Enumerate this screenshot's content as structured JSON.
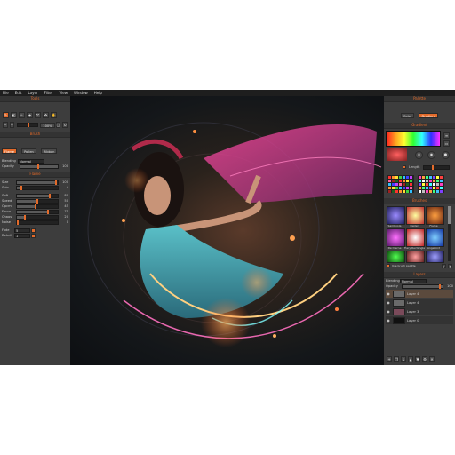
{
  "menu": [
    "File",
    "Edit",
    "Layer",
    "Filter",
    "View",
    "Window",
    "Help"
  ],
  "tools": {
    "title": "Tools",
    "zoom_value": "100%"
  },
  "brush": {
    "title": "Brush",
    "modes": [
      "Flame",
      "Pollen",
      "Ribbon"
    ],
    "blending_label": "Blending",
    "blending_value": "Normal",
    "opacity_label": "Opacity",
    "opacity_value": "100"
  },
  "flame": {
    "title": "Flame",
    "rows": [
      {
        "label": "Size",
        "value": "100",
        "level": 0.95
      },
      {
        "label": "Spin",
        "value": "4",
        "level": 0.1
      }
    ],
    "rows2": [
      {
        "label": "Soft",
        "value": "80",
        "level": 0.8
      },
      {
        "label": "Speed",
        "value": "50",
        "level": 0.5
      },
      {
        "label": "Opcmt",
        "value": "45",
        "level": 0.45
      },
      {
        "label": "Focus",
        "value": "75",
        "level": 0.75
      },
      {
        "label": "Chaos",
        "value": "20",
        "level": 0.2
      },
      {
        "label": "Noise",
        "value": "0",
        "level": 0.02
      }
    ],
    "fade_label": "Fade",
    "fade_value": "5",
    "detail_label": "Detail",
    "detail_value": "1"
  },
  "palette": {
    "title": "Palette",
    "tabs": [
      "Color",
      "Gradient"
    ]
  },
  "gradient": {
    "title": "Gradient",
    "length_label": "Length"
  },
  "brushes": {
    "title": "Brushes",
    "labels": [
      "Samboola",
      "Pastel",
      "Flame",
      "Pacmerne",
      "Fiery Rectangle",
      "Angelbird"
    ],
    "checkbox_label": "Use brush palette"
  },
  "layers": {
    "title": "Layers",
    "blending_label": "Blending",
    "blending_value": "Normal",
    "opacity_label": "Opacity",
    "opacity_value": "100",
    "items": [
      "Layer 4",
      "Layer 4",
      "Layer 3",
      "Layer 0"
    ]
  },
  "colors": {
    "accent": "#e36b2b",
    "panel": "#3d3d3d"
  }
}
